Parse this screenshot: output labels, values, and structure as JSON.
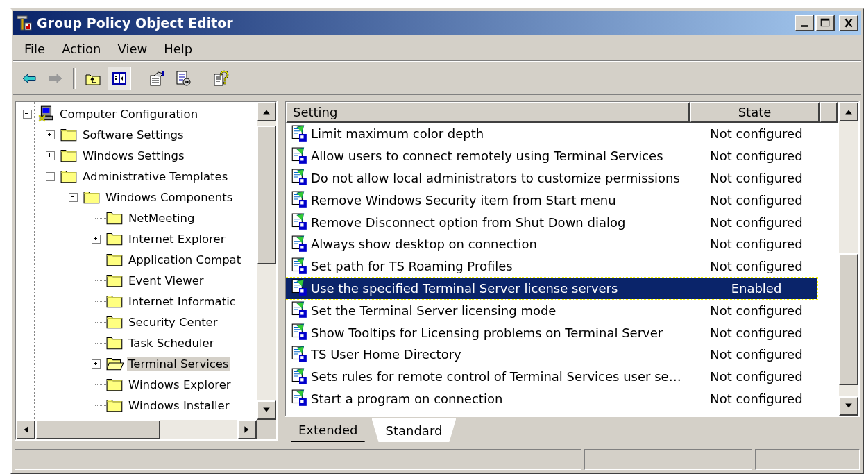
{
  "window": {
    "title": "Group Policy Object Editor"
  },
  "menu": [
    {
      "label": "File"
    },
    {
      "label": "Action"
    },
    {
      "label": "View"
    },
    {
      "label": "Help"
    }
  ],
  "toolbar": [
    {
      "kind": "back",
      "disabled": false,
      "pressed": false
    },
    {
      "kind": "forward",
      "disabled": true,
      "pressed": false
    },
    {
      "kind": "separator"
    },
    {
      "kind": "up",
      "disabled": false,
      "pressed": false
    },
    {
      "kind": "tree",
      "disabled": false,
      "pressed": true
    },
    {
      "kind": "separator"
    },
    {
      "kind": "properties",
      "disabled": false,
      "pressed": false
    },
    {
      "kind": "export",
      "disabled": false,
      "pressed": false
    },
    {
      "kind": "separator"
    },
    {
      "kind": "help",
      "disabled": false,
      "pressed": false
    }
  ],
  "tree": [
    {
      "label": "Computer Configuration",
      "kind": "computer",
      "has_children": true,
      "expanded": true,
      "selected": false,
      "children": [
        {
          "label": "Software Settings",
          "kind": "folder",
          "has_children": true,
          "expanded": false,
          "selected": false
        },
        {
          "label": "Windows Settings",
          "kind": "folder",
          "has_children": true,
          "expanded": false,
          "selected": false
        },
        {
          "label": "Administrative Templates",
          "kind": "folder",
          "has_children": true,
          "expanded": true,
          "selected": false,
          "children": [
            {
              "label": "Windows Components",
              "kind": "folder",
              "has_children": true,
              "expanded": true,
              "selected": false,
              "children": [
                {
                  "label": "NetMeeting",
                  "kind": "folder",
                  "has_children": false,
                  "expanded": false,
                  "selected": false
                },
                {
                  "label": "Internet Explorer",
                  "kind": "folder",
                  "has_children": true,
                  "expanded": false,
                  "selected": false
                },
                {
                  "label": "Application Compat",
                  "kind": "folder",
                  "has_children": false,
                  "expanded": false,
                  "selected": false
                },
                {
                  "label": "Event Viewer",
                  "kind": "folder",
                  "has_children": false,
                  "expanded": false,
                  "selected": false
                },
                {
                  "label": "Internet Informatic",
                  "kind": "folder",
                  "has_children": false,
                  "expanded": false,
                  "selected": false
                },
                {
                  "label": "Security Center",
                  "kind": "folder",
                  "has_children": false,
                  "expanded": false,
                  "selected": false
                },
                {
                  "label": "Task Scheduler",
                  "kind": "folder",
                  "has_children": false,
                  "expanded": false,
                  "selected": false
                },
                {
                  "label": "Terminal Services",
                  "kind": "open-folder",
                  "has_children": true,
                  "expanded": false,
                  "selected": true
                },
                {
                  "label": "Windows Explorer",
                  "kind": "folder",
                  "has_children": false,
                  "expanded": false,
                  "selected": false
                },
                {
                  "label": "Windows Installer",
                  "kind": "folder",
                  "has_children": false,
                  "expanded": false,
                  "selected": false
                }
              ]
            }
          ]
        }
      ]
    }
  ],
  "table": {
    "columns": [
      "Setting",
      "State"
    ],
    "rows": [
      {
        "setting": "Limit maximum color depth",
        "state": "Not configured",
        "selected": false
      },
      {
        "setting": "Allow users to connect remotely using Terminal Services",
        "state": "Not configured",
        "selected": false
      },
      {
        "setting": "Do not allow local administrators to customize permissions",
        "state": "Not configured",
        "selected": false
      },
      {
        "setting": "Remove Windows Security item from Start menu",
        "state": "Not configured",
        "selected": false
      },
      {
        "setting": "Remove Disconnect option from Shut Down dialog",
        "state": "Not configured",
        "selected": false
      },
      {
        "setting": "Always show desktop on connection",
        "state": "Not configured",
        "selected": false
      },
      {
        "setting": "Set path for TS Roaming Profiles",
        "state": "Not configured",
        "selected": false
      },
      {
        "setting": "Use the specified Terminal Server license servers",
        "state": "Enabled",
        "selected": true
      },
      {
        "setting": "Set the Terminal Server licensing mode",
        "state": "Not configured",
        "selected": false
      },
      {
        "setting": "Show Tooltips for Licensing problems on Terminal Server",
        "state": "Not configured",
        "selected": false
      },
      {
        "setting": "TS User Home Directory",
        "state": "Not configured",
        "selected": false
      },
      {
        "setting": "Sets rules for remote control of Terminal Services user se…",
        "state": "Not configured",
        "selected": false
      },
      {
        "setting": "Start a program on connection",
        "state": "Not configured",
        "selected": false
      }
    ]
  },
  "tabs": [
    {
      "label": "Extended",
      "selected": false
    },
    {
      "label": "Standard",
      "selected": true
    }
  ]
}
